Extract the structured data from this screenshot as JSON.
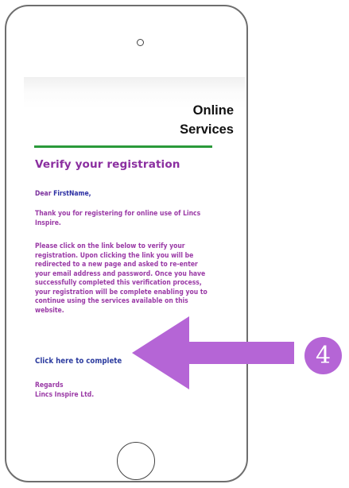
{
  "header": {
    "brand_line1": "Online",
    "brand_line2": "Services"
  },
  "email": {
    "title": "Verify your registration",
    "greeting_prefix": "Dear ",
    "greeting_name": "FirstName,",
    "paragraph1": "Thank you for registering for online use of Lincs Inspire.",
    "paragraph2": "Please click on the link below to verify your registration. Upon clicking the link you will be redirected to a new page and asked to re-enter your email address and password. Once you have successfully completed this verification process, your registration will be complete enabling you to continue using the services available on this website.",
    "link_label": "Click here to complete",
    "regards": "Regards",
    "signature": "Lincs Inspire Ltd."
  },
  "annotation": {
    "step_number": "4",
    "accent_color": "#b565d6"
  }
}
